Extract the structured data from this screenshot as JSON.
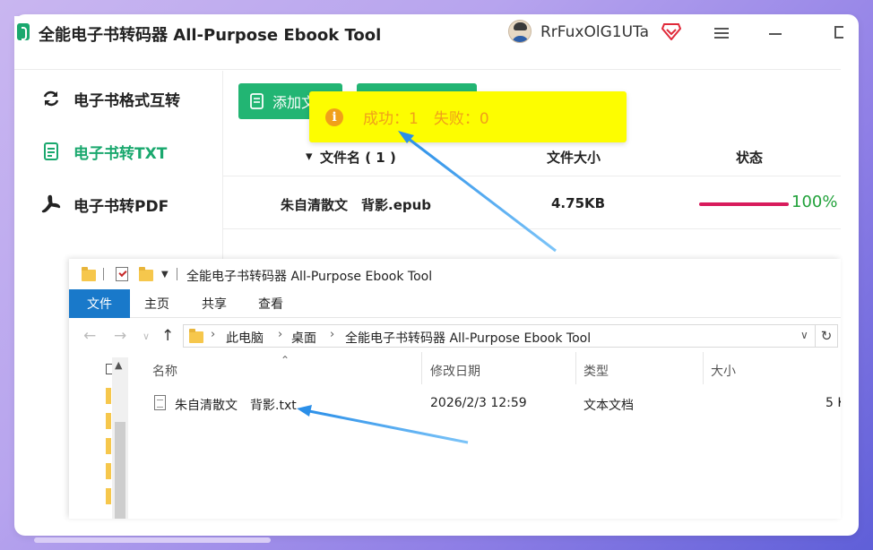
{
  "app": {
    "title": "全能电子书转码器 All-Purpose Ebook Tool",
    "user_name": "RrFuxOlG1UTa"
  },
  "sidebar": {
    "items": [
      {
        "label": "电子书格式互转",
        "icon": "refresh-icon",
        "active": false
      },
      {
        "label": "电子书转TXT",
        "icon": "document-icon",
        "active": true
      },
      {
        "label": "电子书转PDF",
        "icon": "pdf-icon",
        "active": false
      }
    ]
  },
  "toolbar": {
    "add_label": "添加文",
    "accent": "#22b573"
  },
  "table": {
    "headers": {
      "name": "文件名 ( 1 )",
      "size": "文件大小",
      "status": "状态"
    },
    "rows": [
      {
        "name": "朱自清散文　背影.epub",
        "size": "4.75KB",
        "progress": 100,
        "progress_text": "100%"
      }
    ]
  },
  "toast": {
    "text": "成功：1　失败：0",
    "background": "#fdfd00",
    "color": "#f0a01a"
  },
  "explorer": {
    "title": "全能电子书转码器 All-Purpose Ebook Tool",
    "ribbon_tabs": [
      "文件",
      "主页",
      "共享",
      "查看"
    ],
    "breadcrumbs": [
      "此电脑",
      "桌面",
      "全能电子书转码器 All-Purpose Ebook Tool"
    ],
    "columns": [
      "名称",
      "修改日期",
      "类型",
      "大小"
    ],
    "files": [
      {
        "name": "朱自清散文　背影.txt",
        "modified": "2026/2/3 12:59",
        "type": "文本文档",
        "size": "5 K"
      }
    ]
  }
}
